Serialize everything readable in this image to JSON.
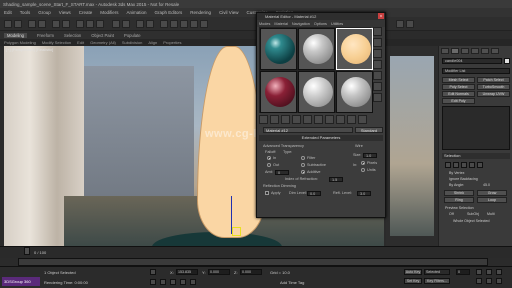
{
  "app": {
    "title": "Shading_sample_scene_Start_F_START.max - Autodesk 3ds Max 2015 - Not for Resale",
    "menu": [
      "Edit",
      "Tools",
      "Group",
      "Views",
      "Create",
      "Modifiers",
      "Animation",
      "Graph Editors",
      "Rendering",
      "Civil View",
      "Customize",
      "Scripting"
    ],
    "ribbon_tabs": [
      "Modeling",
      "Freeform",
      "Selection",
      "Object Paint",
      "Populate"
    ],
    "ribbon_sub": [
      "Polygon Modeling",
      "Modify Selection",
      "Edit",
      "Geometry (All)",
      "Subdivision",
      "Align",
      "Properties"
    ]
  },
  "viewport": {
    "label": "[+] [Perspective] [Realistic]"
  },
  "watermark": "www.cg-ku.com",
  "material_editor": {
    "title": "Material Editor - Material #12",
    "close": "x",
    "menu": [
      "Modes",
      "Material",
      "Navigation",
      "Options",
      "Utilities"
    ],
    "material_name": "Material #12",
    "material_type": "Standard",
    "section": "Extended Parameters",
    "params": {
      "advanced_transparency": "Advanced Transparency",
      "falloff": "Falloff:",
      "type": "Type:",
      "in": "In",
      "out": "Out",
      "filter": "Filter",
      "subtractive": "Subtractive",
      "additive": "Additive",
      "amt": "Amt:",
      "amt_val": "0",
      "index_refraction": "Index of Refraction:",
      "index_val": "1.5",
      "wire": "Wire",
      "size": "Size:",
      "size_val": "1.0",
      "in_label": "In:",
      "pixels": "Pixels",
      "units": "Units",
      "reflection_dimming": "Reflection Dimming",
      "apply": "Apply",
      "dim_level": "Dim Level:",
      "dim_val": "0.0",
      "refl_level": "Refl. Level:",
      "refl_val": "3.0"
    }
  },
  "command_panel": {
    "object_name": "candle004",
    "modifier_list": "Modifier List",
    "buttons": [
      "Mesh Select",
      "Patch Select",
      "Poly Select",
      "TurboSmooth",
      "Edit Normals",
      "Unwrap UVW",
      "Edit Poly"
    ],
    "section_selection": "Selection",
    "by_vertex": "By Vertex",
    "ignore_backfacing": "Ignore Backfacing",
    "by_angle": "By Angle:",
    "angle_val": "45.0",
    "shrink": "Shrink",
    "grow": "Grow",
    "ring": "Ring",
    "loop": "Loop",
    "preview": "Preview Selection",
    "off": "Off",
    "subobj": "SubObj",
    "multi": "Multi",
    "whole_object": "Whole Object Selected"
  },
  "timeline": {
    "frame": "0 / 100"
  },
  "status": {
    "selected": "1 Object Selected",
    "prompt": "Rendering Time: 0:00:00",
    "x": "X:",
    "x_val": "153.835",
    "y": "Y:",
    "y_val": "0.000",
    "z": "Z:",
    "z_val": "0.000",
    "grid": "Grid = 10.0",
    "auto_key": "Auto Key",
    "selected_dd": "Selected",
    "set_key": "Set Key",
    "key_filters": "Key Filters...",
    "add_time_tag": "Add Time Tag",
    "frame_val": "0"
  },
  "logo_text": "3DSGroup 360",
  "colors": {
    "flame": "#fad6a4",
    "sphere_teal": "#1f6a6e",
    "sphere_red": "#8a2036",
    "sphere_orange": "#f7cf93",
    "sphere_grey": "#c9c9c9"
  }
}
